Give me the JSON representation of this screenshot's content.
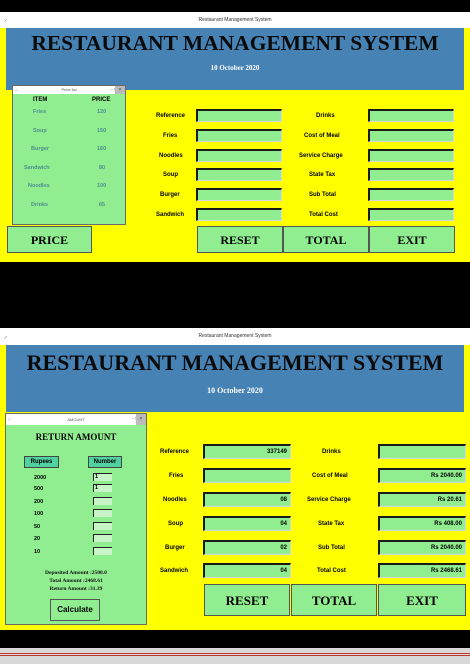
{
  "window_top": {
    "title": "Restaurant Management System",
    "controls": "- □ ×",
    "header_title": "RESTAURANT MANAGEMENT SYSTEM",
    "date": "10 October 2020",
    "price_list": {
      "title": "Price list",
      "controls": "- □",
      "close": "×",
      "item_header": "ITEM",
      "price_header": "PRICE",
      "items": [
        {
          "name": "Fries",
          "price": "120"
        },
        {
          "name": "Soup",
          "price": "150"
        },
        {
          "name": "Burger",
          "price": "160"
        },
        {
          "name": "Sandwich",
          "price": "80"
        },
        {
          "name": "Noodles",
          "price": "100"
        },
        {
          "name": "Drinks",
          "price": "65"
        }
      ]
    },
    "left_labels": [
      "Reference",
      "Fries",
      "Noodles",
      "Soup",
      "Burger",
      "Sandwich"
    ],
    "right_labels": [
      "Drinks",
      "Cost of Meal",
      "Service Charge",
      "State Tax",
      "Sub Total",
      "Total Cost"
    ],
    "buttons": {
      "price": "PRICE",
      "reset": "RESET",
      "total": "TOTAL",
      "exit": "EXIT"
    }
  },
  "window_bottom": {
    "title": "Restaurant Management System",
    "controls": "- □ ×",
    "header_title": "RESTAURANT MANAGEMENT SYSTEM",
    "date": "10 October 2020",
    "amount_window": {
      "title": "AMOUNT",
      "controls": "- □",
      "close": "×",
      "heading": "RETURN AMOUNT",
      "col_rupees": "Rupees",
      "col_number": "Number",
      "rows": [
        {
          "rupee": "2000",
          "number": "1"
        },
        {
          "rupee": "500",
          "number": "1"
        },
        {
          "rupee": "200",
          "number": ""
        },
        {
          "rupee": "100",
          "number": ""
        },
        {
          "rupee": "50",
          "number": ""
        },
        {
          "rupee": "20",
          "number": ""
        },
        {
          "rupee": "10",
          "number": ""
        }
      ],
      "deposited": "Deposited Amount :2500.0",
      "total": "Total Amount :2468.61",
      "return_amount": "Return Amount :31.39",
      "calculate": "Calculate"
    },
    "left_fields": [
      {
        "label": "Reference",
        "value": "337149"
      },
      {
        "label": "Fries",
        "value": ""
      },
      {
        "label": "Noodles",
        "value": "08"
      },
      {
        "label": "Soup",
        "value": "04"
      },
      {
        "label": "Burger",
        "value": "02"
      },
      {
        "label": "Sandwich",
        "value": "04"
      }
    ],
    "right_fields": [
      {
        "label": "Drinks",
        "value": ""
      },
      {
        "label": "Cost of Meal",
        "value": "Rs 2040.00"
      },
      {
        "label": "Service Charge",
        "value": "Rs 20.61"
      },
      {
        "label": "State Tax",
        "value": "Rs 408.00"
      },
      {
        "label": "Sub Total",
        "value": "Rs 2040.00"
      },
      {
        "label": "Total Cost",
        "value": "Rs 2468.61"
      }
    ],
    "buttons": {
      "reset": "RESET",
      "total": "TOTAL",
      "exit": "EXIT"
    }
  },
  "colors": {
    "body_bg": "#ffff00",
    "header_bg": "#4682b4",
    "button_bg": "#90ee90",
    "field_bg": "#90ee90"
  },
  "icons": {
    "app": "feather-icon"
  }
}
